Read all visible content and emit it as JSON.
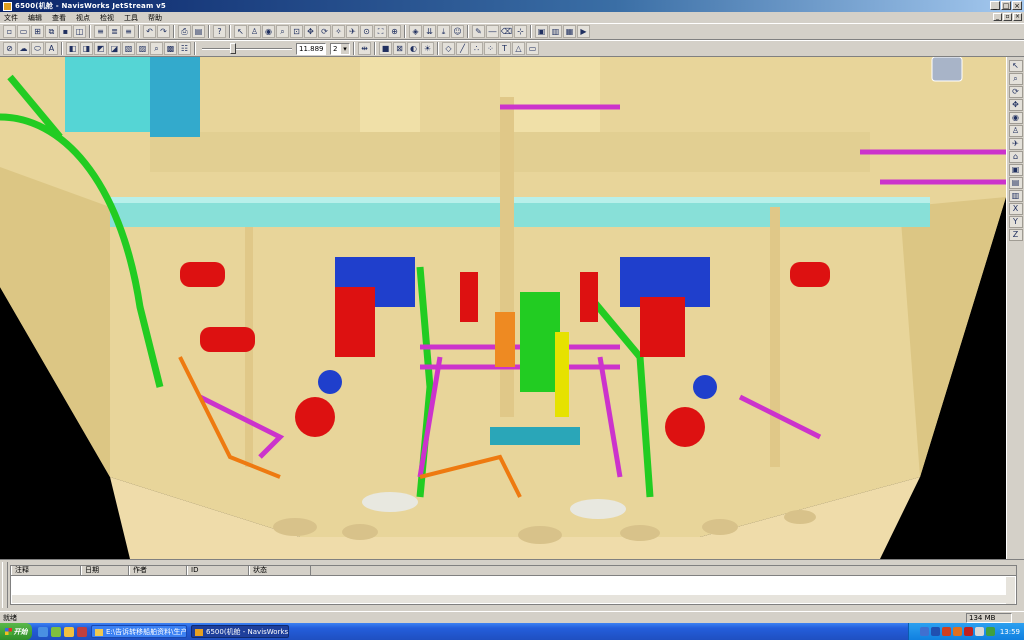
{
  "window": {
    "title": "6500(机舱 - NavisWorks JetStream v5",
    "controls": [
      "_",
      "□",
      "×"
    ]
  },
  "menu": {
    "items": [
      "文件",
      "编辑",
      "查看",
      "视点",
      "检视",
      "工具",
      "帮助"
    ]
  },
  "toolbar2": {
    "speed_value": "11.889",
    "speed_step": "2"
  },
  "results": {
    "columns": [
      "注释",
      "日期",
      "作者",
      "ID",
      "状态"
    ]
  },
  "status": {
    "text": "就绪",
    "panel_value": "134 MB"
  },
  "taskbar": {
    "start_label": "开始",
    "tasks": [
      {
        "label": "E:\\告诉转移船舶资料\\生产..."
      },
      {
        "label": "6500(机舱 - NavisWorks..."
      }
    ],
    "clock": "13:59"
  },
  "side_toolbar": {
    "axis_labels": [
      "X",
      "Y",
      "Z"
    ]
  },
  "colors": {
    "hull": "#e8d59a",
    "background": "#000000",
    "pipe_green": "#22cc22",
    "pipe_magenta": "#cc33cc",
    "engine_blue": "#1f3fcc",
    "equipment_red": "#dd1111",
    "duct_cyan": "#55d5d5"
  }
}
